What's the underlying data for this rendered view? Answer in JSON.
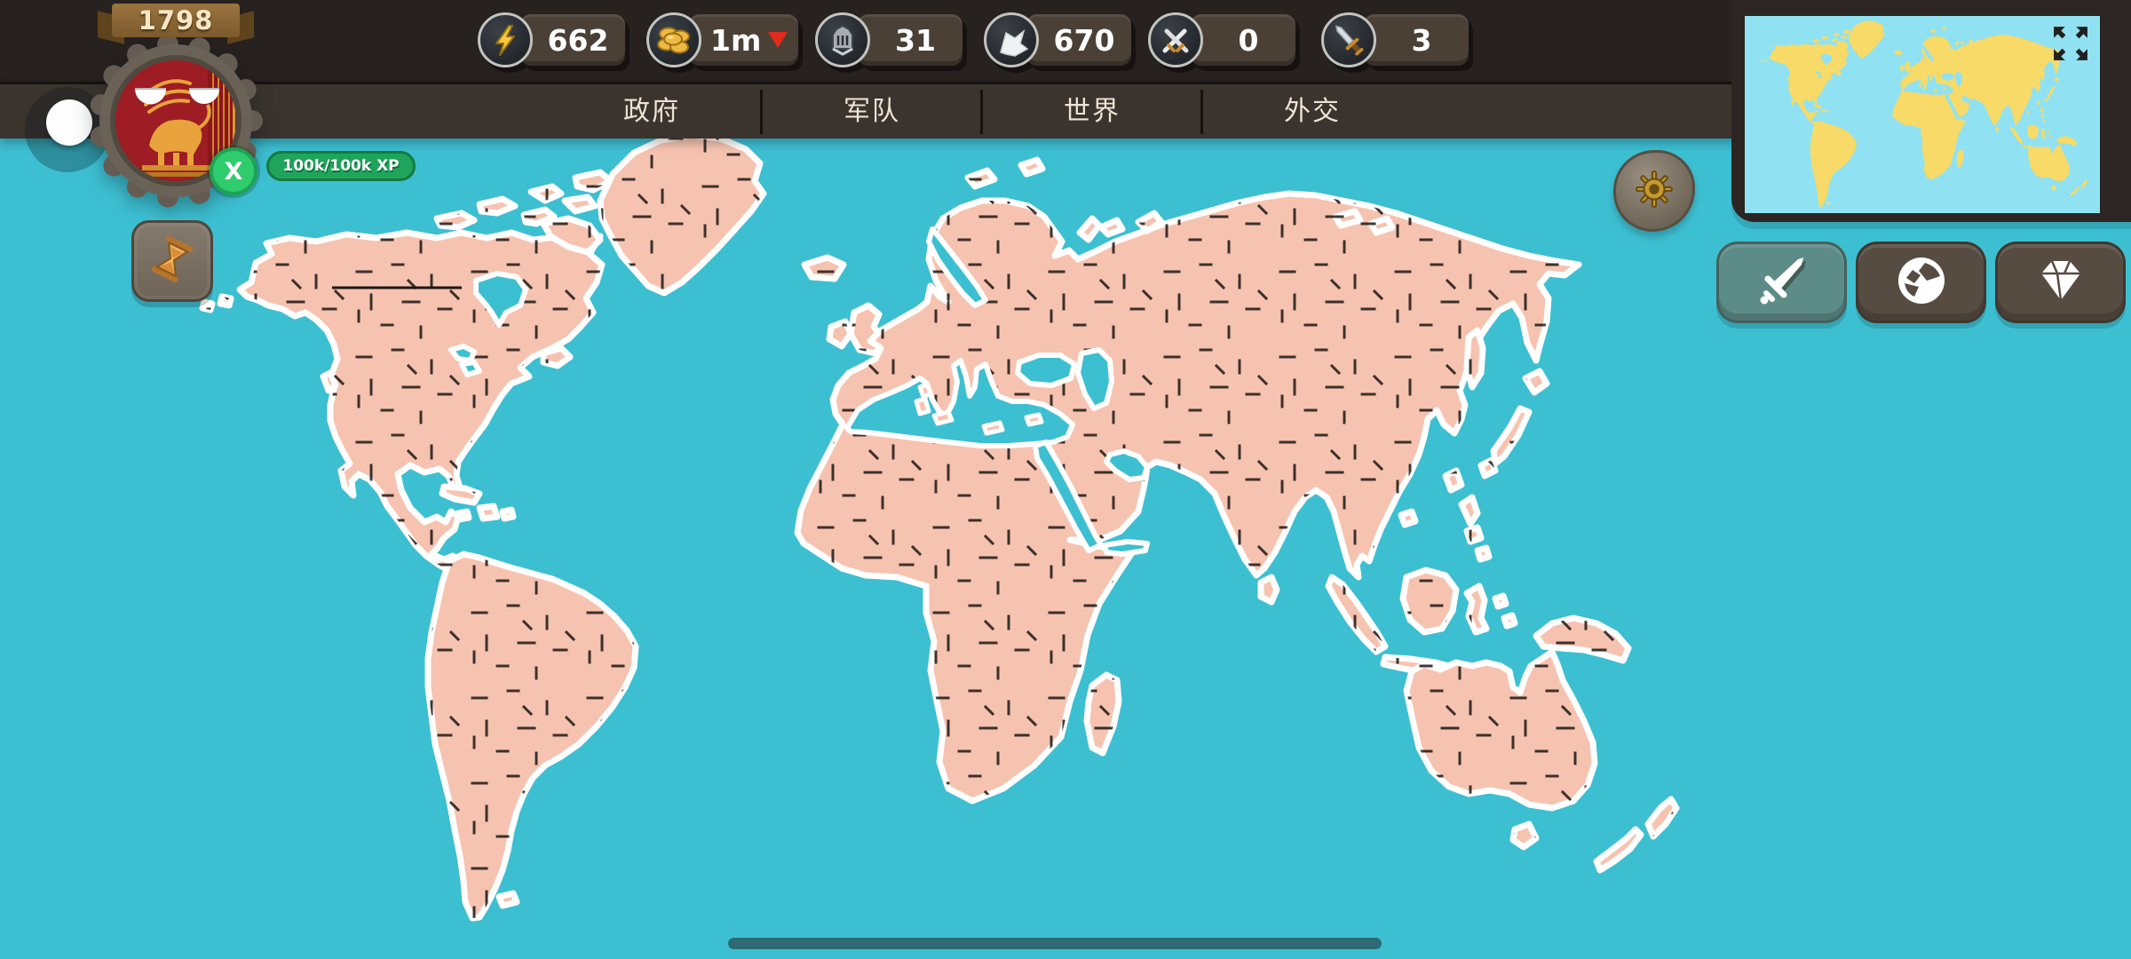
{
  "hud": {
    "year": "1798",
    "player": {
      "xp": "100k/100k XP",
      "close": "X",
      "emblem_icon": "winged-lion-flag-emblem"
    },
    "resources": [
      {
        "id": "energy",
        "icon": "lightning-icon",
        "value": "662"
      },
      {
        "id": "gold",
        "icon": "coins-icon",
        "value": "1m",
        "trend": "down",
        "trend_icon": "red-down-arrow-icon"
      },
      {
        "id": "manpower",
        "icon": "helmet-icon",
        "value": "31"
      },
      {
        "id": "provinces",
        "icon": "banner-icon",
        "value": "670"
      },
      {
        "id": "wars",
        "icon": "crossed-swords-icon",
        "value": "0"
      },
      {
        "id": "armies",
        "icon": "dagger-icon",
        "value": "3"
      }
    ],
    "tabs": [
      {
        "label": "政府"
      },
      {
        "label": "军队"
      },
      {
        "label": "世界"
      },
      {
        "label": "外交"
      }
    ]
  },
  "left_buttons": [
    {
      "icon": "hourglass-icon"
    }
  ],
  "map_buttons": [
    {
      "icon": "gear-icon"
    }
  ],
  "minimap": {
    "expand_icon": "expand-arrows-icon"
  },
  "side_buttons": [
    {
      "id": "war",
      "icon": "sword-icon"
    },
    {
      "id": "world",
      "icon": "globe-icon"
    },
    {
      "id": "premium",
      "icon": "diamond-icon"
    }
  ],
  "colors": {
    "ocean": "#3dbfd2",
    "land": "#f6c3b0",
    "coast": "#ffffff",
    "mini_ocean": "#90e2f2",
    "mini_land": "#f7da67",
    "top_bar": "#272120",
    "tab_bar": "#3a332e",
    "xp_green": "#1fa55b",
    "badge_green": "#2fcc6e",
    "gold_trend_red": "#e02b1d",
    "home_bar": "#2e6a73"
  }
}
